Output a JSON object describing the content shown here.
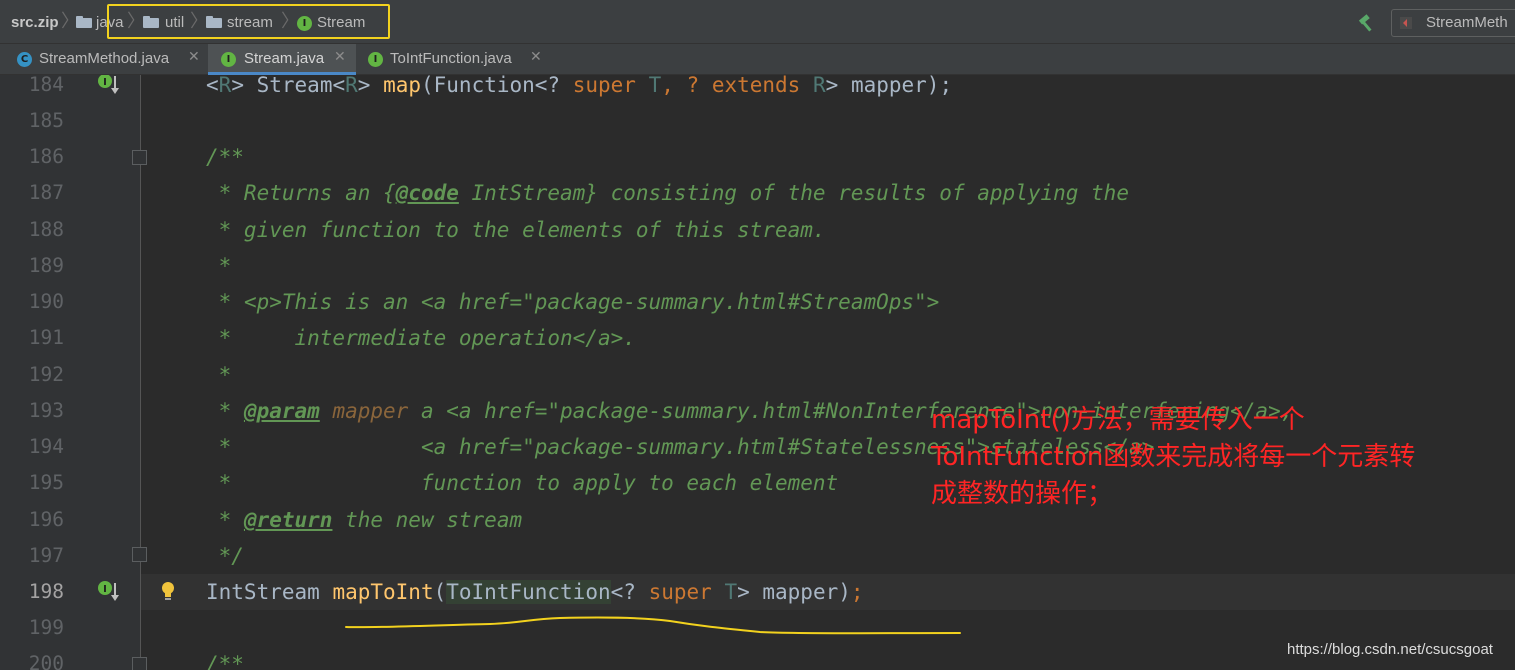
{
  "navbar": {
    "root": "src.zip",
    "crumbs": [
      "java",
      "util",
      "stream"
    ],
    "current": "Stream",
    "run_config": "StreamMeth"
  },
  "tabs": [
    {
      "label": "StreamMethod.java",
      "icon": "class-icon",
      "active": false
    },
    {
      "label": "Stream.java",
      "icon": "interface-icon",
      "active": true
    },
    {
      "label": "ToIntFunction.java",
      "icon": "interface-icon",
      "active": false
    }
  ],
  "editor": {
    "line_numbers": [
      "184",
      "185",
      "186",
      "187",
      "188",
      "189",
      "190",
      "191",
      "192",
      "193",
      "194",
      "195",
      "196",
      "197",
      "198",
      "199",
      "200"
    ],
    "current_line": "198",
    "lines": {
      "l184": {
        "p1": "<",
        "p2": "R",
        "p3": "> Stream<",
        "p4": "R",
        "p5": "> ",
        "p6": "map",
        "p7": "(Function<? ",
        "p8": "super",
        "p9": " ",
        "p10": "T",
        "p11": ", ? ",
        "p12": "extends",
        "p13": " ",
        "p14": "R",
        "p15": "> mapper);"
      },
      "l186": "/**",
      "l187": {
        "a": " * Returns an {",
        "b": "@code",
        "c": " IntStream} consisting of the results of applying the"
      },
      "l188": " * given function to the elements of this stream.",
      "l189": " *",
      "l190": {
        "a": " * ",
        "b": "<p>",
        "c": "This is an ",
        "d": "<a href=\"package-summary.html#StreamOps\">"
      },
      "l191": {
        "a": " *     intermediate operation",
        "b": "</a>",
        "c": "."
      },
      "l192": " *",
      "l193": {
        "a": " * ",
        "b": "@param",
        "c": " ",
        "d": "mapper",
        "e": " a ",
        "f": "<a href=\"package-summary.html#NonInterference\">",
        "g": "non-interfering",
        "h": "</a>",
        "i": ","
      },
      "l194": {
        "a": " *               ",
        "b": "<a href=\"package-summary.html#Statelessness\">",
        "c": "stateless",
        "d": "</a>"
      },
      "l195": " *               function to apply to each element",
      "l196": {
        "a": " * ",
        "b": "@return",
        "c": " the new stream"
      },
      "l197": " */",
      "l198": {
        "a": "IntStream ",
        "b": "mapToInt",
        "c": "(",
        "d": "ToIntFunction",
        "e": "<? ",
        "f": "super",
        "g": " ",
        "h": "T",
        "i": "> mapper)",
        "j": ";"
      },
      "l200": "/**"
    }
  },
  "annotation": {
    "line1": "mapToInt()方法，需要传入一个",
    "line2": "ToIntFunction函数来完成将每一个元素转",
    "line3": "成整数的操作；"
  },
  "watermark": "https://blog.csdn.net/csucsgoat",
  "colors": {
    "background": "#2b2b2b",
    "doc_comment": "#629755",
    "keyword": "#cc7832",
    "method": "#ffc66d",
    "annotation_text": "#ff2525",
    "highlight_box": "#f2d21e",
    "underline": "#f2d21e"
  }
}
